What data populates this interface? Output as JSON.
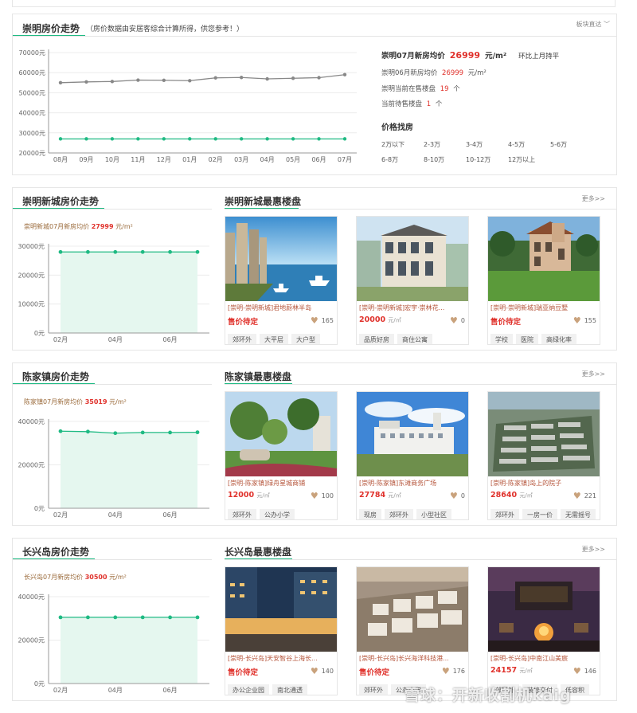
{
  "main": {
    "title": "崇明房价走势",
    "note": "（房价数据由安居客综合计算所得，供您参考！）",
    "selector": "板块直达",
    "chart_data": {
      "type": "line",
      "categories": [
        "08月",
        "09月",
        "10月",
        "11月",
        "12月",
        "01月",
        "02月",
        "03月",
        "04月",
        "05月",
        "06月",
        "07月"
      ],
      "y_ticks": [
        "70000元",
        "60000元",
        "50000元",
        "40000元",
        "30000元",
        "20000元"
      ],
      "ylim": [
        20000,
        70000
      ],
      "series": [
        {
          "color": "#888888",
          "values": [
            55000,
            55400,
            55600,
            56300,
            56200,
            56000,
            57400,
            57600,
            56900,
            57200,
            57500,
            59000
          ]
        },
        {
          "color": "#1fba83",
          "values": [
            27000,
            27000,
            27000,
            27000,
            27000,
            27000,
            27000,
            27000,
            27000,
            27000,
            27000,
            27000
          ]
        }
      ]
    },
    "stats": {
      "line1_label": "崇明07月新房均价",
      "line1_value": "26999",
      "line1_unit": "元/m²",
      "line1_note": "环比上月持平",
      "line2_label": "崇明06月新房均价",
      "line2_value": "26999",
      "line2_unit": "元/m²",
      "line3_label": "崇明当前在售楼盘",
      "line3_value": "19",
      "line3_unit": "个",
      "line4_label": "当前待售楼盘",
      "line4_value": "1",
      "line4_unit": "个"
    },
    "price_find": {
      "title": "价格找房",
      "links": [
        "2万以下",
        "2-3万",
        "3-4万",
        "4-5万",
        "5-6万",
        "6-8万",
        "8-10万",
        "10-12万",
        "12万以上"
      ]
    }
  },
  "sections": [
    {
      "trend_title": "崇明新城房价走势",
      "deals_title": "崇明新城最惠楼盘",
      "more": "更多>>",
      "avg_label": "崇明新城07月新房均价",
      "avg_value": "27999",
      "avg_unit": "元/m²",
      "chart_data": {
        "type": "area",
        "categories": [
          "02月",
          "03月",
          "04月",
          "05月",
          "06月",
          "07月"
        ],
        "x_labels": [
          "02月",
          "",
          "04月",
          "",
          "06月",
          ""
        ],
        "y_ticks": [
          "30000元",
          "20000元",
          "10000元",
          "0元"
        ],
        "ylim": [
          0,
          30000
        ],
        "series": [
          {
            "color": "#1fba83",
            "values": [
              28000,
              28000,
              28000,
              28000,
              28000,
              28000
            ]
          }
        ]
      },
      "cards": [
        {
          "name": "[崇明-崇明新城]君地蔚林半岛",
          "price": "售价待定",
          "unit": "",
          "fav": "165",
          "tags": [
            "郊环外",
            "大平层",
            "大户型"
          ],
          "img": "sea"
        },
        {
          "name": "[崇明-崇明新城]宏宇·崇林花...",
          "price": "20000",
          "unit": "元/㎡",
          "fav": "0",
          "tags": [
            "品质好房",
            "商住公寓"
          ],
          "img": "villa"
        },
        {
          "name": "[崇明-崇明新城]瑞亚纳豆墅",
          "price": "售价待定",
          "unit": "",
          "fav": "155",
          "tags": [
            "学校",
            "医院",
            "高绿化率"
          ],
          "img": "manor"
        }
      ]
    },
    {
      "trend_title": "陈家镇房价走势",
      "deals_title": "陈家镇最惠楼盘",
      "more": "更多>>",
      "avg_label": "陈家镇07月新房均价",
      "avg_value": "35019",
      "avg_unit": "元/m²",
      "chart_data": {
        "type": "area",
        "categories": [
          "02月",
          "03月",
          "04月",
          "05月",
          "06月",
          "07月"
        ],
        "x_labels": [
          "02月",
          "",
          "04月",
          "",
          "06月",
          ""
        ],
        "y_ticks": [
          "40000元",
          "20000元",
          "0元"
        ],
        "ylim": [
          0,
          40000
        ],
        "series": [
          {
            "color": "#1fba83",
            "values": [
              35500,
              35300,
              34600,
              34900,
              34900,
              35000
            ]
          }
        ]
      },
      "cards": [
        {
          "name": "[崇明-陈家镇]绿舟星城商铺",
          "price": "12000",
          "unit": "元/㎡",
          "fav": "100",
          "tags": [
            "郊环外",
            "公办小学"
          ],
          "img": "garden"
        },
        {
          "name": "[崇明-陈家镇]东滩商务广场",
          "price": "27784",
          "unit": "元/㎡",
          "fav": "0",
          "tags": [
            "现房",
            "郊环外",
            "小型社区"
          ],
          "img": "plaza"
        },
        {
          "name": "[崇明-陈家镇]岛上的院子",
          "price": "28640",
          "unit": "元/㎡",
          "fav": "221",
          "tags": [
            "郊环外",
            "一房一价",
            "无需摇号"
          ],
          "img": "aerial"
        }
      ]
    },
    {
      "trend_title": "长兴岛房价走势",
      "deals_title": "长兴岛最惠楼盘",
      "more": "更多>>",
      "avg_label": "长兴岛07月新房均价",
      "avg_value": "30500",
      "avg_unit": "元/m²",
      "chart_data": {
        "type": "area",
        "categories": [
          "02月",
          "03月",
          "04月",
          "05月",
          "06月",
          "07月"
        ],
        "x_labels": [
          "02月",
          "",
          "04月",
          "",
          "06月",
          ""
        ],
        "y_ticks": [
          "40000元",
          "20000元",
          "0元"
        ],
        "ylim": [
          0,
          40000
        ],
        "series": [
          {
            "color": "#1fba83",
            "values": [
              30500,
              30500,
              30500,
              30500,
              30500,
              30500
            ]
          }
        ]
      },
      "cards": [
        {
          "name": "[崇明-长兴岛]天安智谷上海长...",
          "price": "售价待定",
          "unit": "",
          "fav": "140",
          "tags": [
            "办公企业园",
            "南北通透"
          ],
          "img": "night"
        },
        {
          "name": "[崇明-长兴岛]长兴海洋科技港...",
          "price": "售价待定",
          "unit": "",
          "fav": "176",
          "tags": [
            "郊环外",
            "公办小学"
          ],
          "img": "campus"
        },
        {
          "name": "[崇明-长兴岛]中南江山美宸",
          "price": "24157",
          "unit": "元/㎡",
          "fav": "146",
          "tags": [
            "郊环外",
            "装修交付",
            "低容积"
          ],
          "img": "fire"
        }
      ]
    }
  ],
  "watermark": "雪球：开新收割机kaig"
}
